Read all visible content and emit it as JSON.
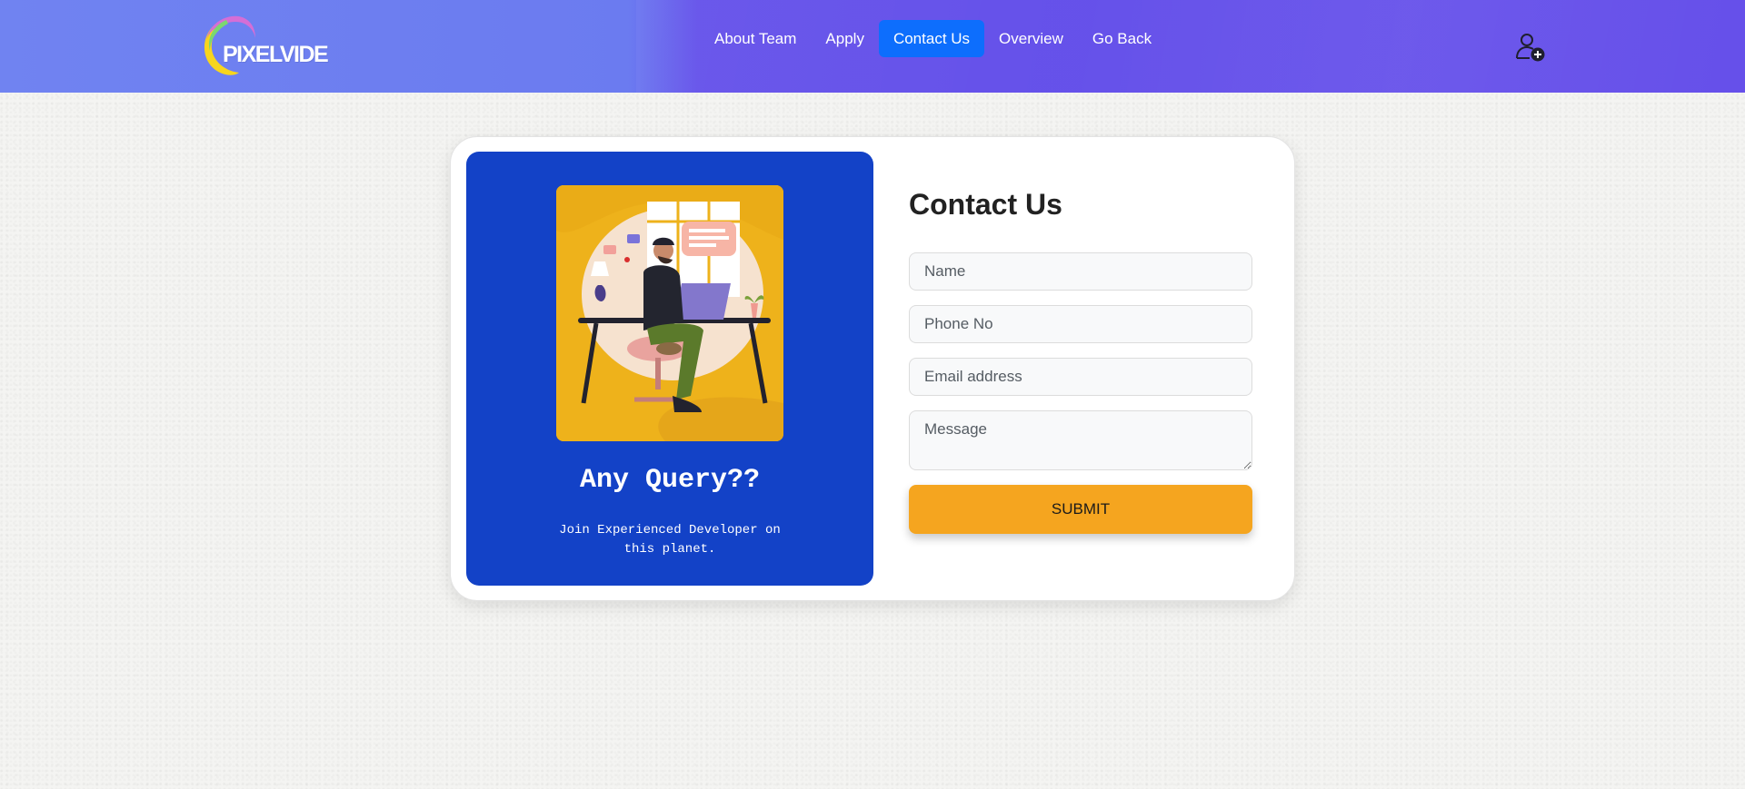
{
  "brand": {
    "logo_text": "PIXELVIDE"
  },
  "nav": {
    "items": [
      {
        "label": "About Team"
      },
      {
        "label": "Apply"
      },
      {
        "label": "Contact Us"
      },
      {
        "label": "Overview"
      },
      {
        "label": "Go Back"
      }
    ],
    "active_label": "Contact Us"
  },
  "left_panel": {
    "heading": "Any Query??",
    "subtext": "Join Experienced Developer on this planet."
  },
  "form": {
    "title": "Contact Us",
    "name_placeholder": "Name",
    "phone_placeholder": "Phone No",
    "email_placeholder": "Email address",
    "message_placeholder": "Message",
    "submit_label": "SUBMIT"
  },
  "colors": {
    "nav_active": "#0d6efd",
    "panel_blue": "#1342c7",
    "submit_orange": "#f5a51f"
  },
  "icons": {
    "user": "user-add-icon"
  }
}
